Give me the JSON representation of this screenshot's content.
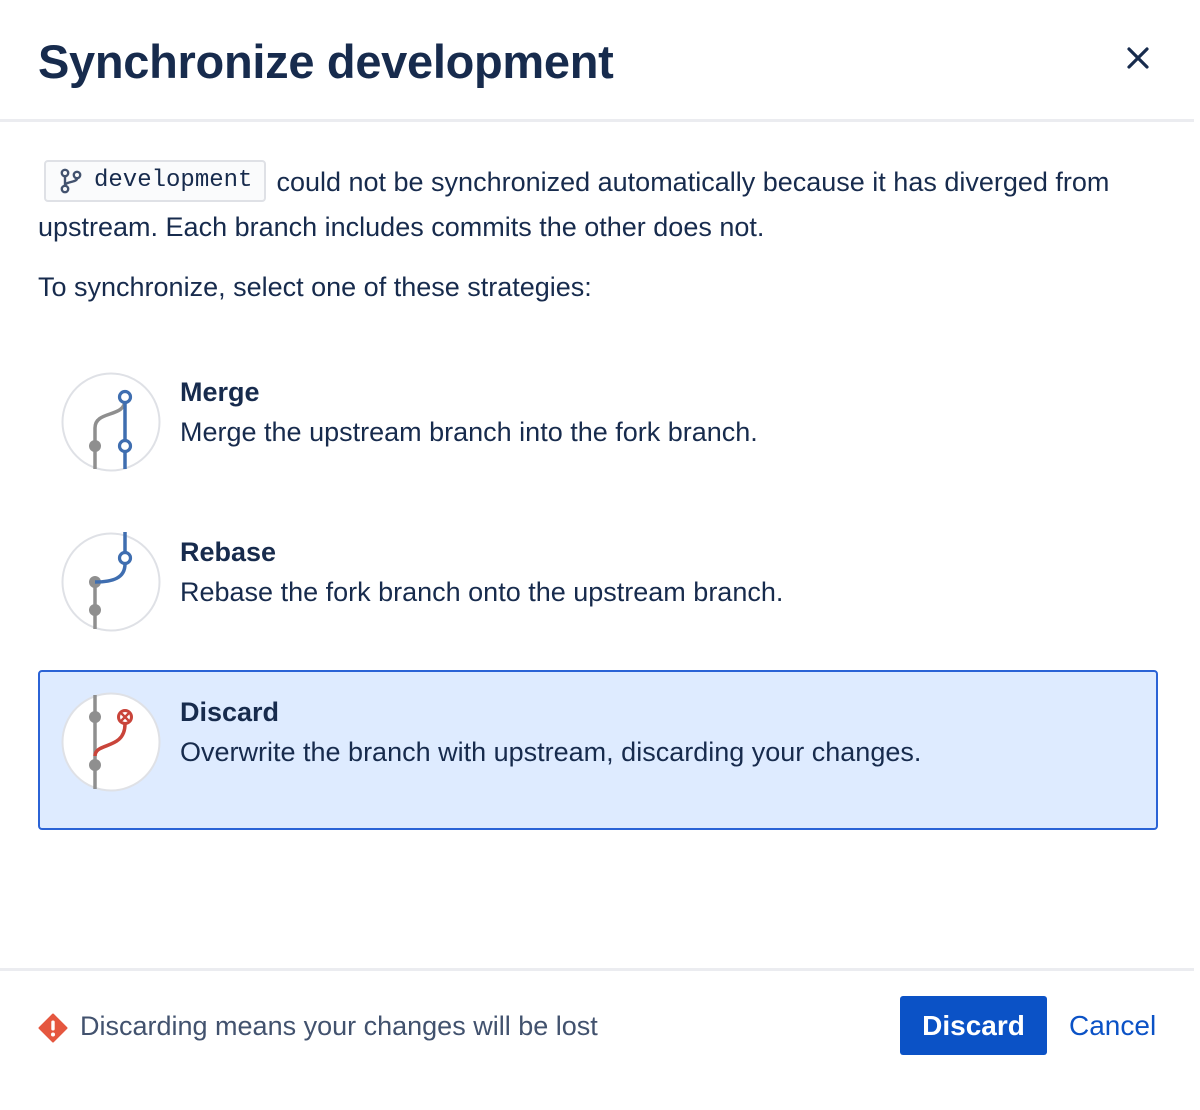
{
  "dialog": {
    "title": "Synchronize development",
    "close_icon": "close-icon"
  },
  "message": {
    "branch_name": "development",
    "branch_icon": "branch-icon",
    "text_line": "could not be synchronized automatically because it has diverged from upstream. Each branch includes commits the other does not.",
    "instruction": "To synchronize, select one of these strategies:"
  },
  "strategies": [
    {
      "title": "Merge",
      "description": "Merge the upstream branch into the fork branch.",
      "icon": "merge-icon",
      "selected": false
    },
    {
      "title": "Rebase",
      "description": "Rebase the fork branch onto the upstream branch.",
      "icon": "rebase-icon",
      "selected": false
    },
    {
      "title": "Discard",
      "description": "Overwrite the branch with upstream, discarding your changes.",
      "icon": "discard-icon",
      "selected": true
    }
  ],
  "footer": {
    "warning_text": "Discarding means your changes will be lost",
    "warning_icon": "warning-icon",
    "primary_label": "Discard",
    "cancel_label": "Cancel"
  },
  "colors": {
    "primary": "#0b52c6",
    "selected_bg": "#deebff",
    "selected_border": "#2b63d6",
    "warning": "#e5573f",
    "text": "#172b4d"
  }
}
